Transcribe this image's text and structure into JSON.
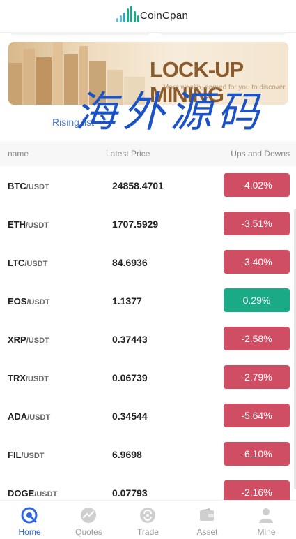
{
  "app": {
    "logo_text": "CoinCpan"
  },
  "banner": {
    "title": "LOCK-UP MINING",
    "subtitle": "More wealth, earned for you to discover"
  },
  "watermark": "海外源码",
  "section": {
    "tab_label": "Rising list"
  },
  "table": {
    "headers": {
      "name": "name",
      "price": "Latest Price",
      "change": "Ups and Downs"
    },
    "rows": [
      {
        "base": "BTC",
        "quote": "/USDT",
        "price": "24858.4701",
        "change": "-4.02%"
      },
      {
        "base": "ETH",
        "quote": "/USDT",
        "price": "1707.5929",
        "change": "-3.51%"
      },
      {
        "base": "LTC",
        "quote": "/USDT",
        "price": "84.6936",
        "change": "-3.40%"
      },
      {
        "base": "EOS",
        "quote": "/USDT",
        "price": "1.1377",
        "change": "0.29%"
      },
      {
        "base": "XRP",
        "quote": "/USDT",
        "price": "0.37443",
        "change": "-2.58%"
      },
      {
        "base": "TRX",
        "quote": "/USDT",
        "price": "0.06739",
        "change": "-2.79%"
      },
      {
        "base": "ADA",
        "quote": "/USDT",
        "price": "0.34544",
        "change": "-5.64%"
      },
      {
        "base": "FIL",
        "quote": "/USDT",
        "price": "6.9698",
        "change": "-6.10%"
      },
      {
        "base": "DOGE",
        "quote": "/USDT",
        "price": "0.07793",
        "change": "-2.16%"
      }
    ]
  },
  "nav": {
    "tabs": [
      {
        "label": "Home",
        "icon": "home-icon",
        "active": true
      },
      {
        "label": "Quotes",
        "icon": "chart-icon",
        "active": false
      },
      {
        "label": "Trade",
        "icon": "exchange-icon",
        "active": false
      },
      {
        "label": "Asset",
        "icon": "wallet-icon",
        "active": false
      },
      {
        "label": "Mine",
        "icon": "user-icon",
        "active": false
      }
    ]
  },
  "colors": {
    "down": "#cf4e63",
    "up": "#1aab86",
    "accent": "#2d66e0"
  }
}
